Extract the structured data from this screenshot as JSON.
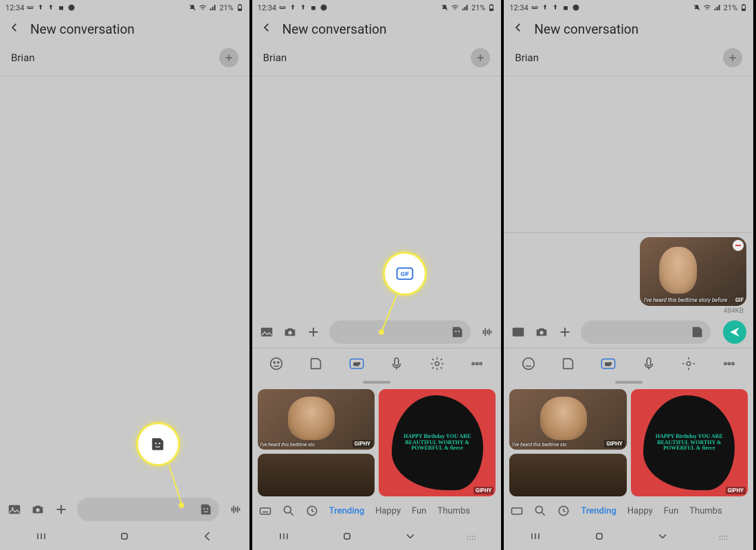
{
  "status": {
    "time": "12:34",
    "battery_text": "21%",
    "icons_left": [
      "voicemail",
      "up-arrow",
      "up-arrow",
      "android",
      "spotify"
    ],
    "icons_right": [
      "mute",
      "wifi",
      "signal",
      "battery"
    ]
  },
  "header": {
    "title": "New conversation"
  },
  "recipient": {
    "name": "Brian"
  },
  "attachment": {
    "caption": "I've heard this bedtime story before",
    "badge": "GIF",
    "size": "484KB"
  },
  "keyboard_tabs": [
    "emoji",
    "sticker",
    "gif",
    "mic",
    "settings",
    "more"
  ],
  "gif_categories": {
    "active": "Trending",
    "items": [
      "Trending",
      "Happy",
      "Fun",
      "Thumbs"
    ]
  },
  "gif_cells": {
    "cell1_caption": "I've heard this bedtime sto",
    "birthday_text": "HAPPY Birthday YOU ARE BEAUTIFUL WORTHY & POWERFUL & fierce",
    "giphy": "GIPHY"
  },
  "callouts": {
    "panel1": "sticker-icon",
    "panel2": "gif-icon"
  },
  "colors": {
    "highlight": "#f4e94d",
    "active_blue": "#2a7fe0",
    "send_teal": "#1db8a0"
  }
}
